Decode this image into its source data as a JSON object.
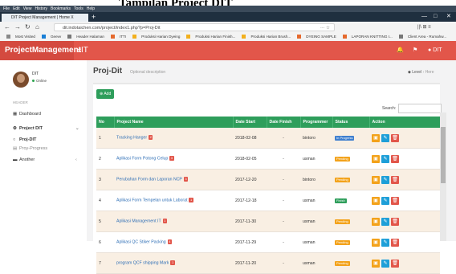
{
  "caption": "Tampilan Project DIT",
  "browser": {
    "menu": [
      "File",
      "Edit",
      "View",
      "History",
      "Bookmarks",
      "Tools",
      "Help"
    ],
    "tab_title": "DIT Project Management | Home X",
    "new_tab": "+",
    "url": "dit.indotaichen.com/project/index1.php?p=Proj-Dit",
    "url_tools": "··· ☆",
    "right_tools": "||\\ ⊞ ≡",
    "bookmarks": [
      {
        "label": "Most Visited",
        "color": "#888888"
      },
      {
        "label": "Geevv",
        "color": "#1a7fd6"
      },
      {
        "label": "Header Halaman",
        "color": "#777777"
      },
      {
        "label": "ITTI",
        "color": "#e56a2e"
      },
      {
        "label": "Produksi Harian Dyeing",
        "color": "#f2b01e"
      },
      {
        "label": "Produksi Harian Finish...",
        "color": "#f2b01e"
      },
      {
        "label": "Produksi Harian Brush...",
        "color": "#f2b01e"
      },
      {
        "label": "DYEING SAMPLE",
        "color": "#e56a2e"
      },
      {
        "label": "LAPORAN KNITTING I...",
        "color": "#e56a2e"
      },
      {
        "label": "Client Area - Rumahw...",
        "color": "#777777"
      }
    ]
  },
  "app": {
    "logo_a": "ProjectManagement",
    "logo_b": "IT",
    "header_user": "DIT",
    "colors": {
      "header": "#e2564a",
      "green": "#2e9e5b"
    }
  },
  "sidebar": {
    "user_name": "DIT",
    "user_status": "Online",
    "section": "HEADER",
    "items": [
      {
        "label": "Dashboard",
        "icon": "dashboard-icon"
      },
      {
        "label": "Project DIT",
        "icon": "gear-icon"
      },
      {
        "label": "Proj-DIT",
        "icon": "circle-icon"
      },
      {
        "label": "Proy-Progress",
        "icon": "doc-icon"
      },
      {
        "label": "Another",
        "icon": "folder-icon"
      }
    ]
  },
  "page": {
    "title": "Proj-Dit",
    "description": "Optional description",
    "breadcrumb_level": "Level",
    "breadcrumb_here": "Here",
    "add_label": "Add",
    "search_label": "Search:"
  },
  "table": {
    "columns": [
      "No",
      "Project Name",
      "Date Start",
      "Date Finish",
      "Programmer",
      "Status",
      "Action"
    ],
    "rows": [
      {
        "no": "1",
        "name": "Tracking Hanger",
        "count": "2",
        "start": "2018-02-08",
        "finish": "-",
        "programmer": "bintoro",
        "status": "In Progress",
        "status_color": "#3f7fcf"
      },
      {
        "no": "2",
        "name": "Aplikasi Form Potong Celup",
        "count": "3",
        "start": "2018-02-05",
        "finish": "-",
        "programmer": "usman",
        "status": "Pending",
        "status_color": "#f3a21a"
      },
      {
        "no": "3",
        "name": "Perubahan Form dan Laporan NCP",
        "count": "3",
        "start": "2017-12-20",
        "finish": "-",
        "programmer": "bintoro",
        "status": "Pending",
        "status_color": "#f3a21a"
      },
      {
        "no": "4",
        "name": "Aplikasi Form Tempelan untuk Laborat",
        "count": "1",
        "start": "2017-12-18",
        "finish": "-",
        "programmer": "usman",
        "status": "Finish",
        "status_color": "#2e9e5b"
      },
      {
        "no": "5",
        "name": "Aplikasi Management IT",
        "count": "1",
        "start": "2017-11-30",
        "finish": "-",
        "programmer": "usman",
        "status": "Pending",
        "status_color": "#f3a21a"
      },
      {
        "no": "6",
        "name": "Aplikasi QC Stiker Packing",
        "count": "4",
        "start": "2017-11-29",
        "finish": "-",
        "programmer": "usman",
        "status": "Pending",
        "status_color": "#f3a21a"
      },
      {
        "no": "7",
        "name": "program QCF shipping Mark",
        "count": "1",
        "start": "2017-11-20",
        "finish": "-",
        "programmer": "usman",
        "status": "Pending",
        "status_color": "#f3a21a"
      }
    ]
  }
}
